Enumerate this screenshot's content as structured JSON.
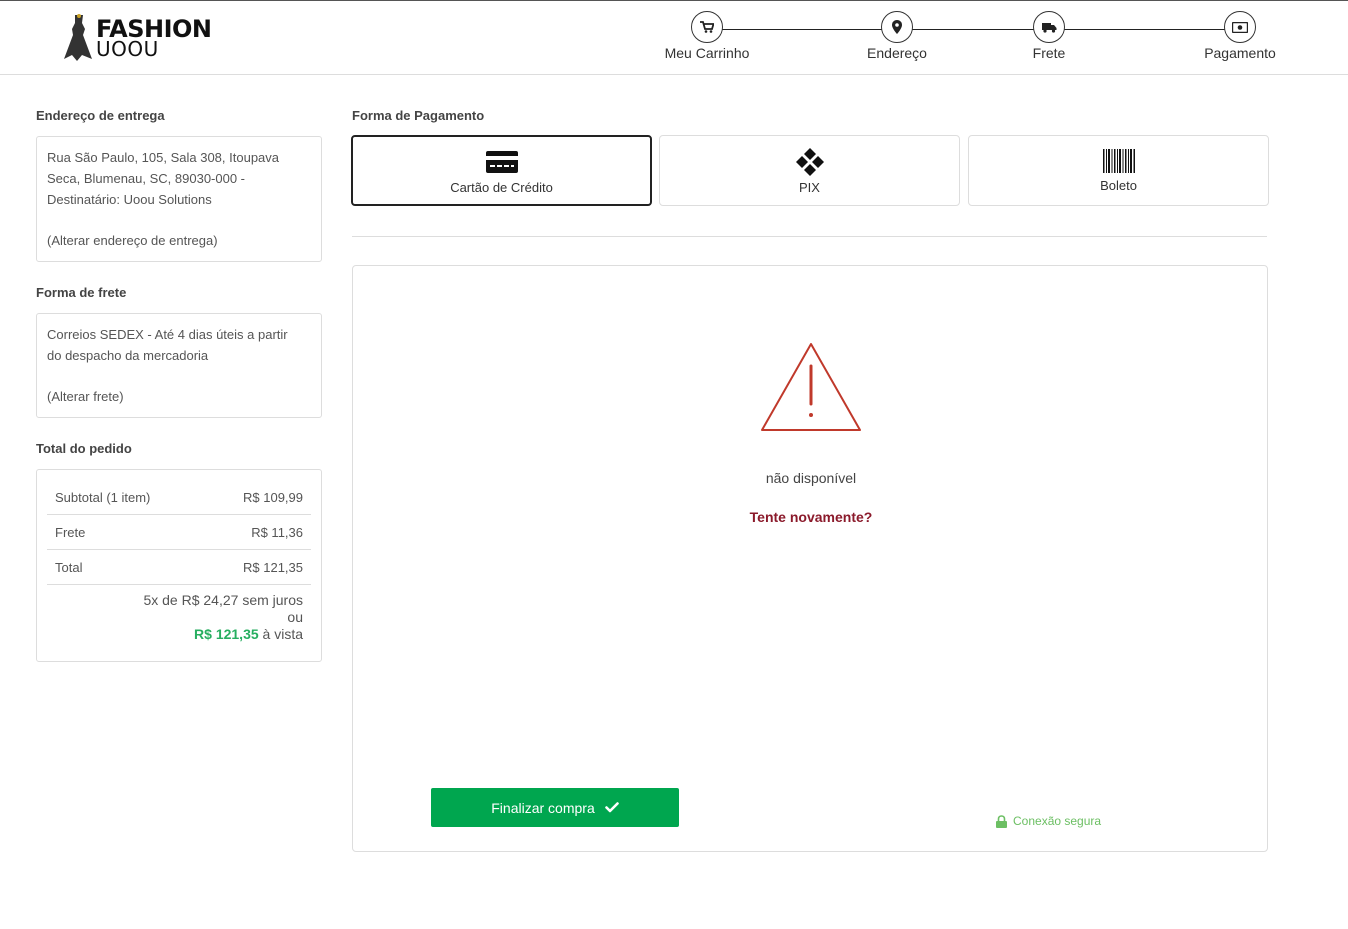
{
  "header": {
    "logo_line1": "FASHION",
    "logo_line2": "UOOU",
    "steps": [
      {
        "label": "Meu Carrinho",
        "icon": "cart-icon"
      },
      {
        "label": "Endereço",
        "icon": "map-pin-icon"
      },
      {
        "label": "Frete",
        "icon": "truck-icon"
      },
      {
        "label": "Pagamento",
        "icon": "money-icon"
      }
    ]
  },
  "sidebar": {
    "address_title": "Endereço de entrega",
    "address_lines": [
      "Rua São Paulo, 105, Sala 308, Itoupava",
      "Seca, Blumenau, SC, 89030-000 -",
      "Destinatário: Uoou Solutions"
    ],
    "address_change": "(Alterar endereço de entrega)",
    "shipping_title": "Forma de frete",
    "shipping_lines": [
      "Correios SEDEX - Até 4 dias úteis a partir",
      "do despacho da mercadoria"
    ],
    "shipping_change": "(Alterar frete)",
    "total_title": "Total do pedido",
    "totals": [
      {
        "label": "Subtotal (1 item)",
        "value": "R$ 109,99"
      },
      {
        "label": "Frete",
        "value": "R$ 11,36"
      },
      {
        "label": "Total",
        "value": "R$ 121,35"
      }
    ],
    "installments": "5x de R$ 24,27 sem juros",
    "or": "ou",
    "cash_price": "R$ 121,35",
    "cash_suffix": " à vista"
  },
  "payment": {
    "title": "Forma de Pagamento",
    "methods": [
      {
        "label": "Cartão de Crédito",
        "icon": "credit-card-icon",
        "selected": true
      },
      {
        "label": "PIX",
        "icon": "pix-icon",
        "selected": false
      },
      {
        "label": "Boleto",
        "icon": "barcode-icon",
        "selected": false
      }
    ],
    "error_text": "não disponível",
    "retry": "Tente novamente?",
    "finish_button": "Finalizar compra",
    "secure": "Conexão segura"
  },
  "colors": {
    "accent_green": "#00a64f",
    "price_green": "#27ae60",
    "error_red": "#c0392b",
    "retry_red": "#8b1a2b"
  }
}
